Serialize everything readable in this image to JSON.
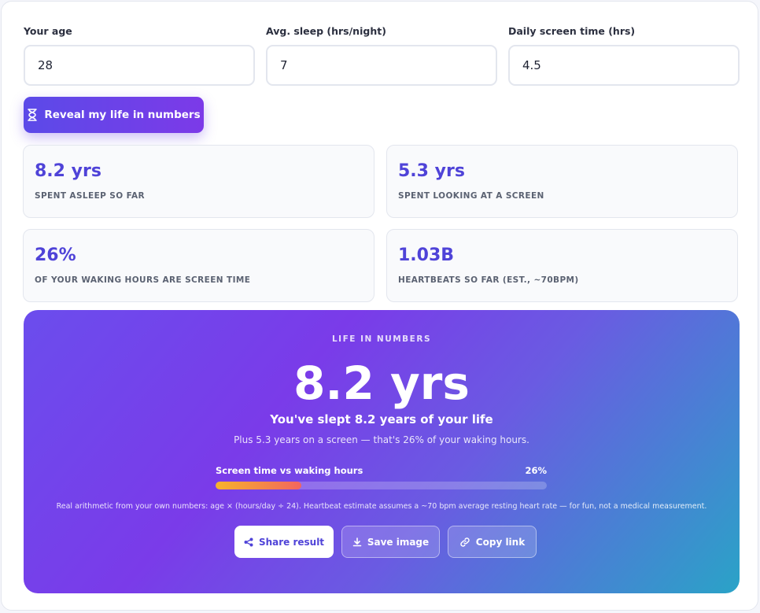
{
  "inputs": {
    "age": {
      "label": "Your age",
      "value": "28"
    },
    "sleep": {
      "label": "Avg. sleep (hrs/night)",
      "value": "7"
    },
    "screen": {
      "label": "Daily screen time (hrs)",
      "value": "4.5"
    }
  },
  "reveal_button": {
    "label": "Reveal my life in numbers",
    "icon": "hourglass-icon"
  },
  "stats": [
    {
      "value": "8.2 yrs",
      "label": "SPENT ASLEEP SO FAR"
    },
    {
      "value": "5.3 yrs",
      "label": "SPENT LOOKING AT A SCREEN"
    },
    {
      "value": "26%",
      "label": "OF YOUR WAKING HOURS ARE SCREEN TIME"
    },
    {
      "value": "1.03B",
      "label": "HEARTBEATS SO FAR (EST., ~70BPM)"
    }
  ],
  "hero": {
    "eyebrow": "LIFE IN NUMBERS",
    "big_value": "8.2 yrs",
    "headline": "You've slept 8.2 years of your life",
    "subline": "Plus 5.3 years on a screen — that's 26% of your waking hours.",
    "progress": {
      "label": "Screen time vs waking hours",
      "value_text": "26%",
      "fraction": 0.26
    },
    "note": "Real arithmetic from your own numbers: age × (hours/day ÷ 24). Heartbeat estimate assumes a ~70 bpm average resting heart rate — for fun, not a medical measurement."
  },
  "actions": {
    "share": {
      "label": "Share result",
      "icon": "share-icon"
    },
    "save": {
      "label": "Save image",
      "icon": "download-icon"
    },
    "copy": {
      "label": "Copy link",
      "icon": "link-icon"
    }
  },
  "colors": {
    "accent": "#4f43d8",
    "hero_start": "#6b4ded",
    "hero_end": "#2aa3c7",
    "progress_start": "#f7b32b",
    "progress_end": "#f3655e"
  }
}
